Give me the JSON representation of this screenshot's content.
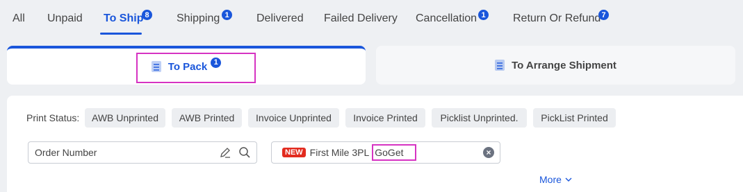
{
  "tabs": [
    {
      "label": "All"
    },
    {
      "label": "Unpaid"
    },
    {
      "label": "To Ship",
      "badge": "8"
    },
    {
      "label": "Shipping",
      "badge": "1"
    },
    {
      "label": "Delivered"
    },
    {
      "label": "Failed Delivery"
    },
    {
      "label": "Cancellation",
      "badge": "1"
    },
    {
      "label": "Return Or Refund",
      "badge": "7"
    }
  ],
  "subtabs": {
    "to_pack": {
      "label": "To Pack",
      "badge": "1"
    },
    "to_arrange": {
      "label": "To Arrange Shipment"
    }
  },
  "print_status": {
    "label": "Print Status:",
    "chips": [
      "AWB Unprinted",
      "AWB Printed",
      "Invoice Unprinted",
      "Invoice Printed",
      "Picklist Unprinted.",
      "PickList Printed"
    ]
  },
  "filters": {
    "order_placeholder": "Order Number",
    "new_tag": "NEW",
    "tpl_label": "First Mile 3PL",
    "tpl_value": "GoGet",
    "clear": "×"
  },
  "more_label": "More",
  "colors": {
    "accent": "#1a56db",
    "highlight": "#d633c2",
    "new_tag": "#e22b1f"
  }
}
